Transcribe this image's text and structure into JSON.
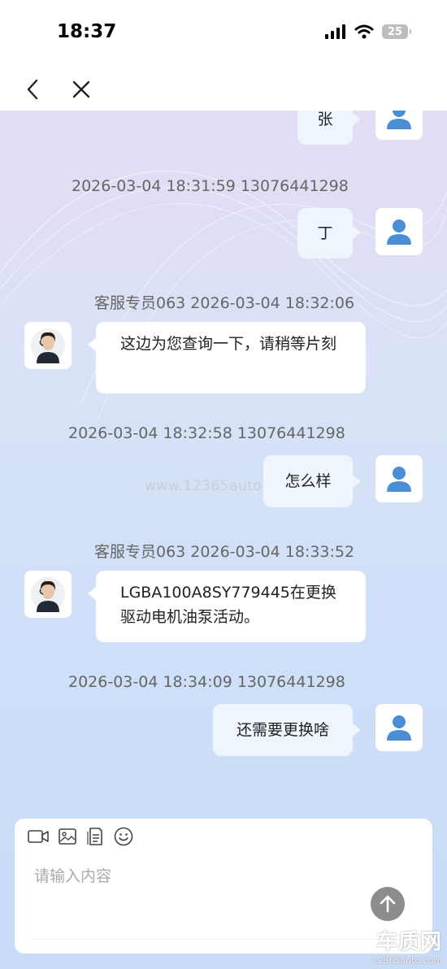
{
  "status": {
    "time": "18:37",
    "battery": "25"
  },
  "nav": {
    "back_icon": "chevron-left-icon",
    "close_icon": "close-icon"
  },
  "messages": [
    {
      "side": "right",
      "text": "张"
    },
    {
      "meta": "2026-03-04 18:31:59   13076441298"
    },
    {
      "side": "right",
      "text": "丁"
    },
    {
      "meta": "客服专员063   2026-03-04 18:32:06"
    },
    {
      "side": "left",
      "text": "这边为您查询一下，请稍等片刻"
    },
    {
      "meta": "2026-03-04 18:32:58   13076441298"
    },
    {
      "side": "right",
      "text": "怎么样"
    },
    {
      "meta": "客服专员063   2026-03-04 18:33:52"
    },
    {
      "side": "left",
      "text": "LGBA100A8SY779445在更换驱动电机油泵活动。"
    },
    {
      "meta": "2026-03-04 18:34:09   13076441298"
    },
    {
      "side": "right",
      "text": "还需要更换啥"
    }
  ],
  "watermark": "www.12365auto.com",
  "input": {
    "placeholder": "请输入内容",
    "tools": [
      "video-icon",
      "image-icon",
      "document-icon",
      "emoji-icon"
    ]
  },
  "logo": {
    "main": "车质网",
    "sub": "12365auto.com"
  },
  "colors": {
    "user_avatar": "#4a8fd6",
    "send_button": "#8c8c8c",
    "bubble_right": "#eef5fd"
  }
}
